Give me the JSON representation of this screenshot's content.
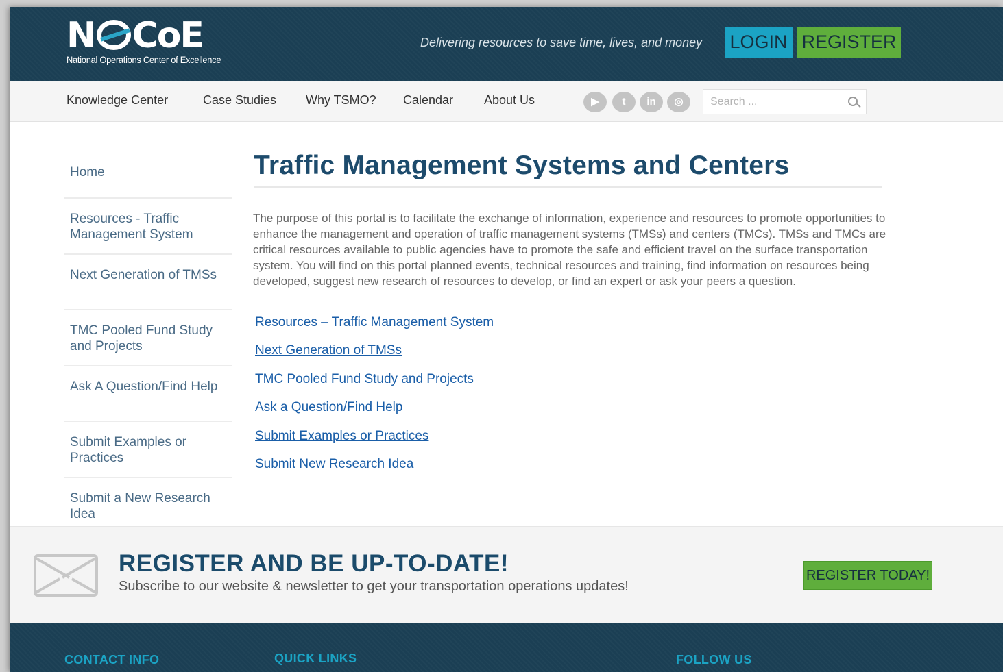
{
  "header": {
    "logo_text": "NOCoE",
    "logo_n": "N",
    "logo_rest": "CoE",
    "logo_subtitle": "National Operations Center of Excellence",
    "tagline": "Delivering resources to save time, lives, and money",
    "login_label": "LOGIN",
    "register_label": "REGISTER",
    "colors": {
      "header_bg": "#1b3f54",
      "login_bg": "#1ba3c4",
      "register_bg": "#5fae3c"
    }
  },
  "nav": {
    "items": [
      {
        "label": "Knowledge Center"
      },
      {
        "label": "Case Studies"
      },
      {
        "label": "Why TSMO?"
      },
      {
        "label": "Calendar"
      },
      {
        "label": "About Us"
      }
    ],
    "social": [
      {
        "icon": "youtube-icon",
        "glyph": "▶"
      },
      {
        "icon": "twitter-icon",
        "glyph": "t"
      },
      {
        "icon": "linkedin-icon",
        "glyph": "in"
      },
      {
        "icon": "instagram-icon",
        "glyph": "◎"
      }
    ],
    "search_placeholder": "Search ..."
  },
  "sidebar": {
    "items": [
      {
        "label": "Home"
      },
      {
        "label": "Resources - Traffic Management System"
      },
      {
        "label": "Next Generation of TMSs"
      },
      {
        "label": "TMC Pooled Fund Study and Projects"
      },
      {
        "label": "Ask A Question/Find Help"
      },
      {
        "label": "Submit Examples or Practices"
      },
      {
        "label": "Submit a New Research Idea"
      }
    ]
  },
  "main": {
    "title": "Traffic Management Systems and Centers",
    "intro": "The purpose of this portal is to facilitate the exchange of information, experience and resources to promote opportunities to enhance the management and operation of traffic management systems (TMSs) and centers (TMCs).  TMSs and TMCs are critical resources available to public agencies have to promote the safe and efficient travel on the surface transportation system.  You will find on this portal planned events, technical resources and training, find information on resources being developed, suggest new research of resources to develop, or find an expert or ask your peers a question.",
    "links": [
      {
        "label": "Resources – Traffic Management System"
      },
      {
        "label": "Next Generation of TMSs"
      },
      {
        "label": "TMC Pooled Fund Study and Projects"
      },
      {
        "label": "Ask a Question/Find Help"
      },
      {
        "label": "Submit Examples or Practices"
      },
      {
        "label": "Submit New Research Idea"
      }
    ]
  },
  "register_band": {
    "title": "REGISTER AND BE UP-TO-DATE!",
    "subtitle": "Subscribe to our website & newsletter to get your transportation operations updates!",
    "button_label": "REGISTER TODAY!"
  },
  "footer": {
    "headings": [
      "CONTACT INFO",
      "QUICK LINKS",
      "FOLLOW US"
    ]
  }
}
